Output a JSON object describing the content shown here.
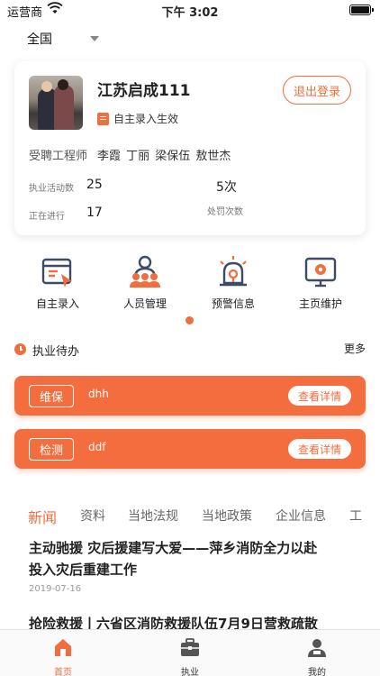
{
  "status_bar": {
    "carrier": "运营商",
    "time": "下午 3:02"
  },
  "region": {
    "label": "全国"
  },
  "profile": {
    "company_name": "江苏启成111",
    "status": "自主录入生效",
    "logout_label": "退出登录",
    "engineers_label": "受聘工程师",
    "engineers": "李霞 丁丽 梁保伍 敖世杰",
    "stats": {
      "activity_label": "执业活动数",
      "activity_value": "25",
      "penalty_value": "5次",
      "in_progress_label": "正在进行",
      "in_progress_value": "17",
      "penalty_label": "处罚次数"
    }
  },
  "quick_menu": [
    {
      "label": "自主录入",
      "icon": "entry-icon"
    },
    {
      "label": "人员管理",
      "icon": "people-icon"
    },
    {
      "label": "预警信息",
      "icon": "alarm-icon"
    },
    {
      "label": "主页维护",
      "icon": "monitor-gear-icon"
    }
  ],
  "todo": {
    "title": "执业待办",
    "more": "更多",
    "items": [
      {
        "tag": "维保",
        "name": "dhh",
        "action": "查看详情"
      },
      {
        "tag": "检测",
        "name": "ddf",
        "action": "查看详情"
      }
    ]
  },
  "news": {
    "tabs": [
      "新闻",
      "资料",
      "当地法规",
      "当地政策",
      "企业信息",
      "工"
    ],
    "active_tab": "新闻",
    "items": [
      {
        "title_line1": "主动驰援 灾后援建写大爱——萍乡消防全力以赴",
        "title_line2": "投入灾后重建工作",
        "date": "2019-07-16"
      },
      {
        "title_line1": "抢险救援丨六省区消防救援队伍7月9日营救疏散"
      }
    ]
  },
  "tab_bar": [
    {
      "label": "首页",
      "icon": "home-icon",
      "active": true
    },
    {
      "label": "执业",
      "icon": "briefcase-icon",
      "active": false
    },
    {
      "label": "我的",
      "icon": "user-icon",
      "active": false
    }
  ],
  "colors": {
    "accent": "#f26d3d",
    "accent_fill": "#f46d3f"
  }
}
